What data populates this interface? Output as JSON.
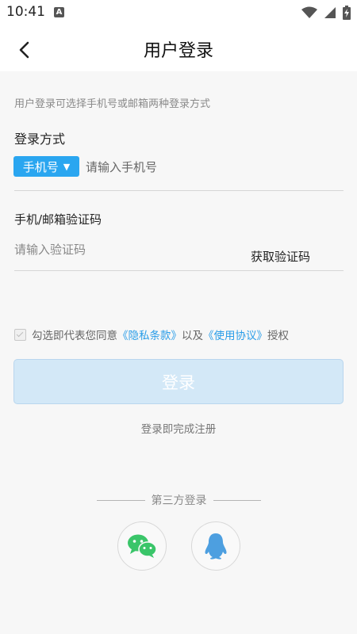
{
  "status_bar": {
    "time": "10:41",
    "notification_icon": "a-icon"
  },
  "header": {
    "title": "用户登录",
    "back_icon": "chevron-left-icon"
  },
  "hint": "用户登录可选择手机号或邮箱两种登录方式",
  "login_method": {
    "label": "登录方式",
    "selected_type": "手机号",
    "caret": "▼",
    "input_placeholder": "请输入手机号",
    "input_value": ""
  },
  "verification": {
    "label": "手机/邮箱验证码",
    "input_placeholder": "请输入验证码",
    "input_value": "",
    "get_code_label": "获取验证码"
  },
  "agreement": {
    "prefix": "勾选即代表您同意",
    "privacy_link": "《隐私条款》",
    "middle": "以及",
    "terms_link": "《使用协议》",
    "suffix": "授权"
  },
  "login_button": "登录",
  "register_note": "登录即完成注册",
  "third_party": {
    "title": "第三方登录",
    "providers": [
      "wechat-icon",
      "qq-icon"
    ]
  },
  "colors": {
    "accent": "#2aa6f0",
    "link": "#2a9de8",
    "login_button_bg": "#d3e8f7",
    "wechat": "#3ac569",
    "qq": "#4d9fe0"
  }
}
